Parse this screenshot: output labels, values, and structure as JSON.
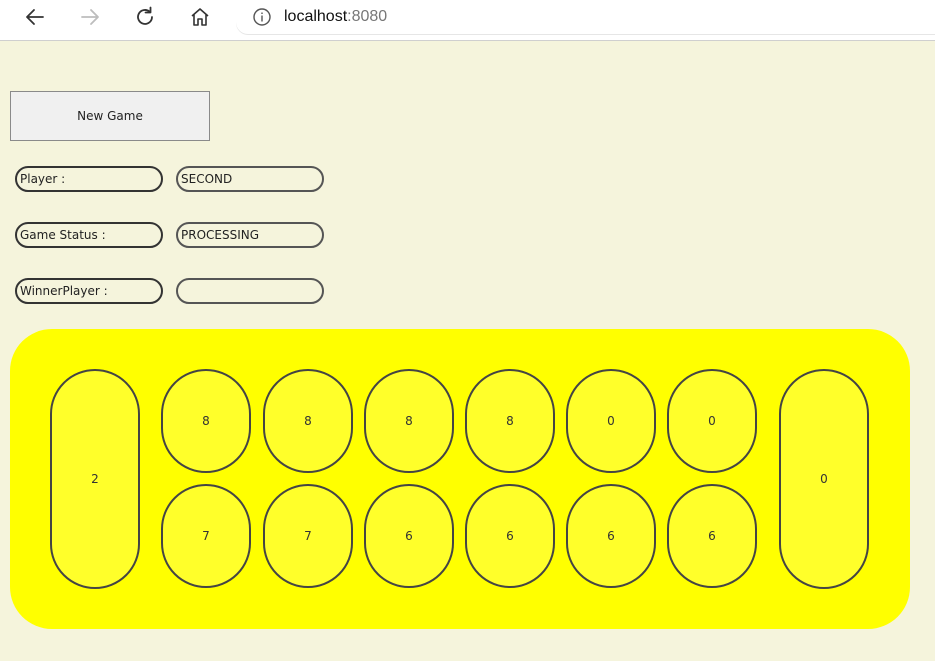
{
  "browser": {
    "url_host": "localhost",
    "url_port": ":8080"
  },
  "controls": {
    "new_game_label": "New Game",
    "player_label": "Player :",
    "player_value": "SECOND",
    "status_label": "Game Status :",
    "status_value": "PROCESSING",
    "winner_label": "WinnerPlayer :",
    "winner_value": ""
  },
  "board": {
    "left_store": "2",
    "right_store": "0",
    "top_pits": [
      "8",
      "8",
      "8",
      "8",
      "0",
      "0"
    ],
    "bottom_pits": [
      "7",
      "7",
      "6",
      "6",
      "6",
      "6"
    ]
  },
  "colors": {
    "board": "#ffff00",
    "background": "#f5f4dc"
  }
}
